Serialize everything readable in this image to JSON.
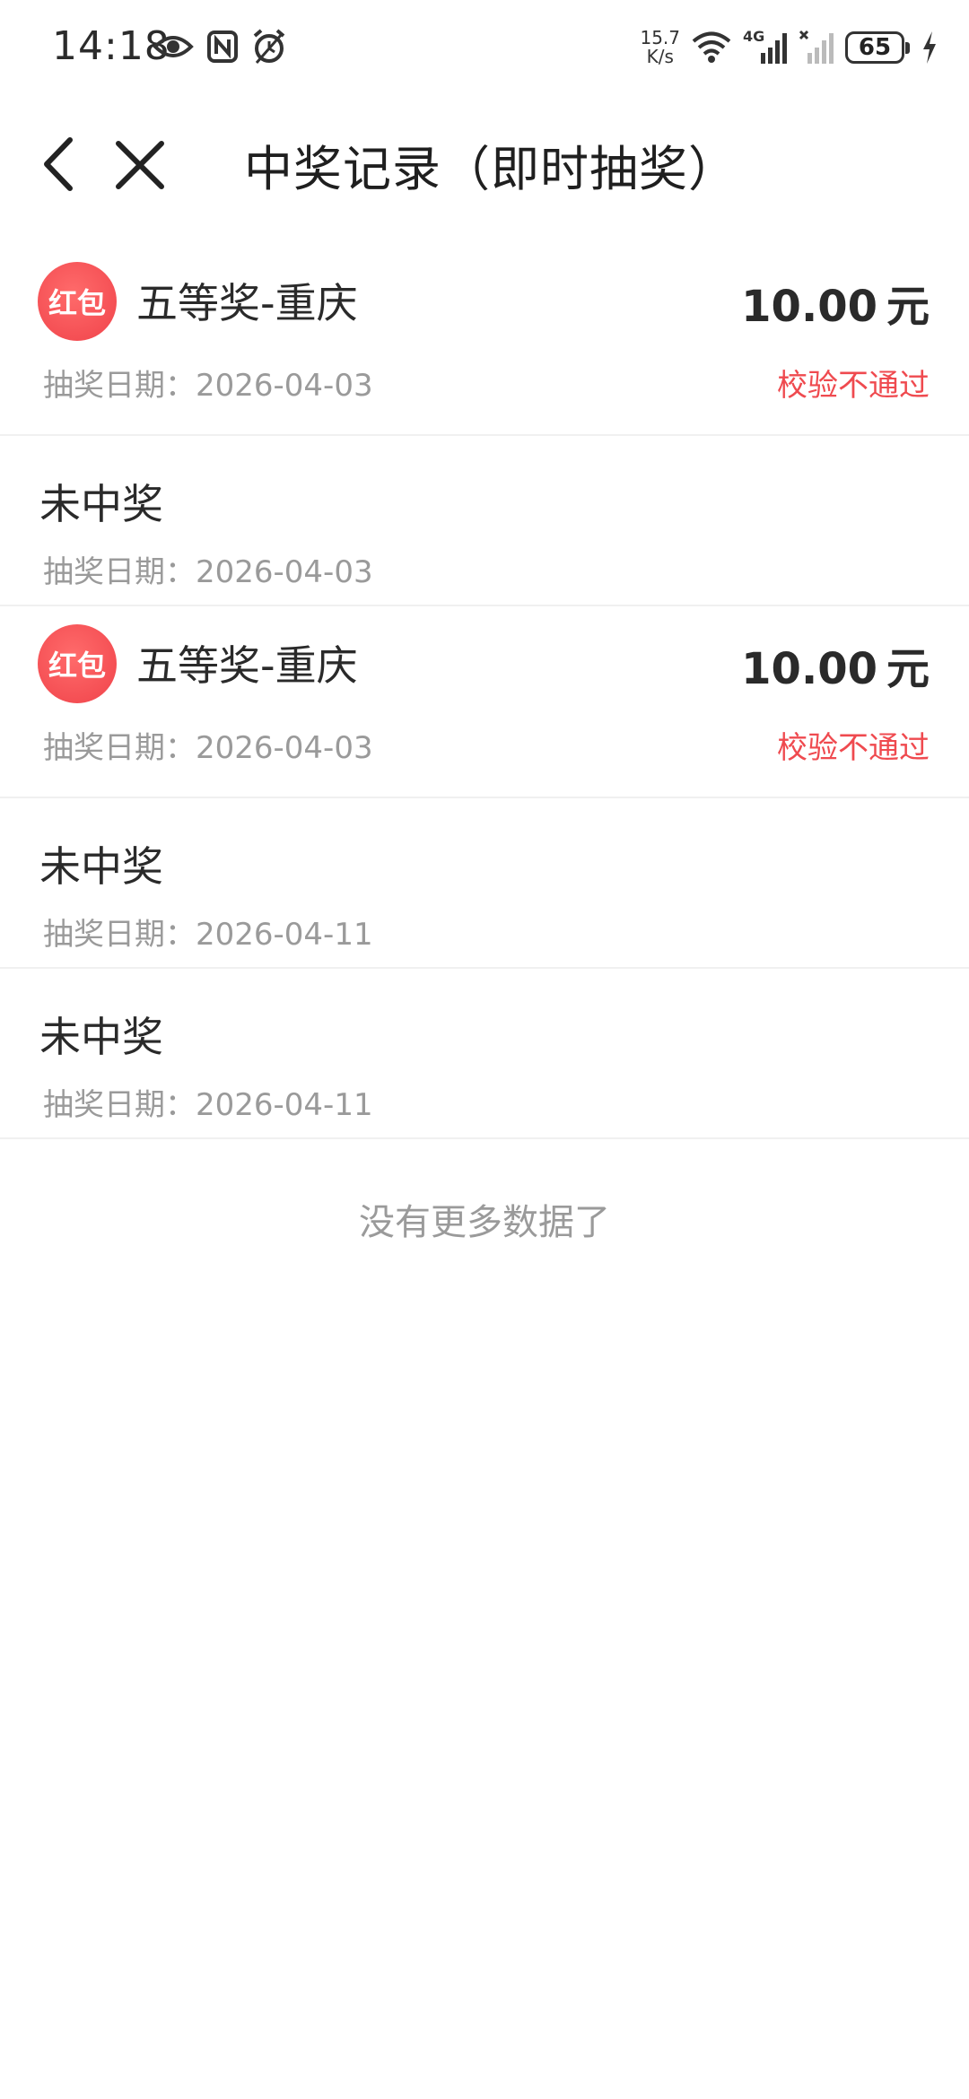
{
  "status_bar": {
    "time": "14:18",
    "net_speed_value": "15.7",
    "net_speed_unit": "K/s",
    "network_label": "4G",
    "battery": "65",
    "icons": [
      "eye-icon",
      "nfc-icon",
      "alarm-icon",
      "wifi-icon",
      "signal-icon",
      "signal-off-icon",
      "charging-icon"
    ]
  },
  "nav": {
    "title": "中奖记录（即时抽奖）",
    "back_icon": "chevron-left-icon",
    "close_icon": "close-icon"
  },
  "records": [
    {
      "type": "win",
      "badge": "红包",
      "prize": "五等奖-重庆",
      "amount": "10.00",
      "unit": "元",
      "date_label": "抽奖日期：",
      "date": "2026-04-03",
      "status": "校验不通过"
    },
    {
      "type": "lose",
      "prize": "未中奖",
      "date_label": "抽奖日期：",
      "date": "2026-04-03"
    },
    {
      "type": "win",
      "badge": "红包",
      "prize": "五等奖-重庆",
      "amount": "10.00",
      "unit": "元",
      "date_label": "抽奖日期：",
      "date": "2026-04-03",
      "status": "校验不通过"
    },
    {
      "type": "lose",
      "prize": "未中奖",
      "date_label": "抽奖日期：",
      "date": "2026-04-11"
    },
    {
      "type": "lose",
      "prize": "未中奖",
      "date_label": "抽奖日期：",
      "date": "2026-04-11"
    }
  ],
  "footer": {
    "no_more": "没有更多数据了"
  },
  "colors": {
    "accent_red": "#ef4a4f",
    "text_primary": "#2a2a2a",
    "text_secondary": "#9a9a9a"
  }
}
